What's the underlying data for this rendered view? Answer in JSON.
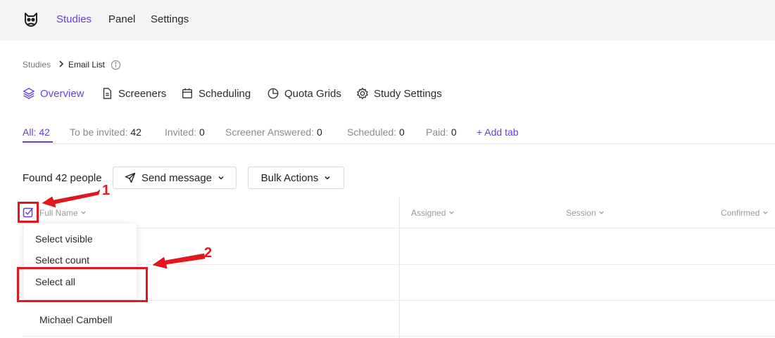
{
  "nav": {
    "items": [
      {
        "label": "Studies",
        "active": true
      },
      {
        "label": "Panel"
      },
      {
        "label": "Settings"
      }
    ]
  },
  "breadcrumb": {
    "parent": "Studies",
    "current": "Email List"
  },
  "study_tabs": [
    {
      "label": "Overview",
      "icon": "layers-icon",
      "active": true
    },
    {
      "label": "Screeners",
      "icon": "document-icon"
    },
    {
      "label": "Scheduling",
      "icon": "calendar-icon"
    },
    {
      "label": "Quota Grids",
      "icon": "pie-chart-icon"
    },
    {
      "label": "Study Settings",
      "icon": "gear-icon"
    }
  ],
  "filter_tabs": [
    {
      "label": "All:",
      "count": "42",
      "active": true
    },
    {
      "label": "To be invited:",
      "count": "42"
    },
    {
      "label": "Invited:",
      "count": "0"
    },
    {
      "label": "Screener Answered:",
      "count": "0"
    },
    {
      "label": "Scheduled:",
      "count": "0"
    },
    {
      "label": "Paid:",
      "count": "0"
    }
  ],
  "add_tab_label": "+ Add tab",
  "toolbar": {
    "found_text": "Found 42 people",
    "send_message_label": "Send message",
    "bulk_actions_label": "Bulk Actions"
  },
  "table": {
    "columns": [
      "Full Name",
      "Assigned",
      "Session",
      "Confirmed"
    ],
    "rows": [
      {
        "name": "Michael Cambell"
      }
    ]
  },
  "select_menu": {
    "items": [
      "Select visible",
      "Select count",
      "Select all"
    ]
  },
  "annotations": {
    "label_1": "1",
    "label_2": "2"
  },
  "colors": {
    "accent": "#6a3fd6",
    "annotation": "#e8141b"
  }
}
